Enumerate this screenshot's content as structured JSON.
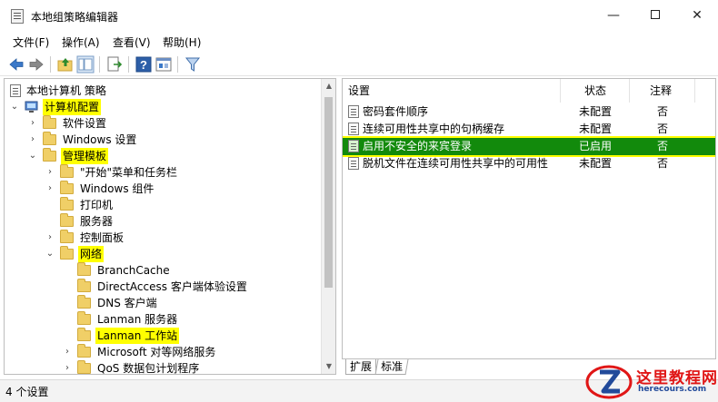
{
  "window": {
    "title": "本地组策略编辑器",
    "minimize_glyph": "—",
    "close_glyph": "✕"
  },
  "menu": [
    "文件(F)",
    "操作(A)",
    "查看(V)",
    "帮助(H)"
  ],
  "tree": {
    "root": "本地计算机 策略",
    "computer_config": "计算机配置",
    "software_settings": "软件设置",
    "windows_settings": "Windows 设置",
    "admin_templates": "管理模板",
    "start_menu": "\"开始\"菜单和任务栏",
    "windows_components": "Windows 组件",
    "printers": "打印机",
    "server": "服务器",
    "control_panel": "控制面板",
    "network": "网络",
    "branchcache": "BranchCache",
    "directaccess": "DirectAccess 客户端体验设置",
    "dns_client": "DNS 客户端",
    "lanman_server": "Lanman 服务器",
    "lanman_workstation": "Lanman 工作站",
    "microsoft_p2p": "Microsoft 对等网络服务",
    "qos": "QoS 数据包计划程序"
  },
  "list": {
    "headers": [
      "设置",
      "状态",
      "注释"
    ],
    "rows": [
      {
        "name": "密码套件顺序",
        "state": "未配置",
        "comment": "否"
      },
      {
        "name": "连续可用性共享中的句柄缓存",
        "state": "未配置",
        "comment": "否"
      },
      {
        "name": "启用不安全的来宾登录",
        "state": "已启用",
        "comment": "否"
      },
      {
        "name": "脱机文件在连续可用性共享中的可用性",
        "state": "未配置",
        "comment": "否"
      }
    ]
  },
  "tabs": [
    "扩展",
    "标准"
  ],
  "status": "4 个设置",
  "watermark": {
    "name": "这里教程网",
    "url": "herecours.com"
  },
  "colors": {
    "highlight": "#ffff00",
    "selected_row": "#128a0c",
    "watermark_red": "#e01616",
    "watermark_blue": "#224a9a"
  }
}
